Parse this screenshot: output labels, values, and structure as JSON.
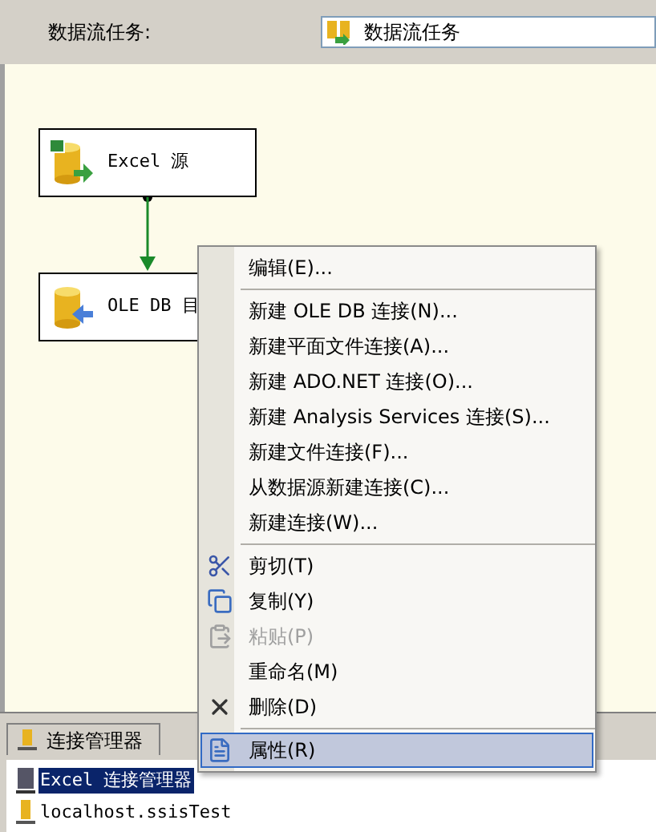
{
  "header": {
    "label": "数据流任务:",
    "combo_value": "数据流任务"
  },
  "canvas": {
    "nodes": [
      {
        "kind": "excel",
        "label": "Excel 源"
      },
      {
        "kind": "oledb",
        "label": "OLE DB 目"
      }
    ]
  },
  "context_menu": [
    {
      "kind": "plain",
      "label": "编辑(E)...",
      "disabled": false,
      "selected": false
    },
    {
      "kind": "separator"
    },
    {
      "kind": "plain",
      "label": "新建 OLE DB 连接(N)...",
      "disabled": false,
      "selected": false
    },
    {
      "kind": "plain",
      "label": "新建平面文件连接(A)...",
      "disabled": false,
      "selected": false
    },
    {
      "kind": "plain",
      "label": "新建 ADO.NET 连接(O)...",
      "disabled": false,
      "selected": false
    },
    {
      "kind": "plain",
      "label": "新建 Analysis Services 连接(S)...",
      "disabled": false,
      "selected": false
    },
    {
      "kind": "plain",
      "label": "新建文件连接(F)...",
      "disabled": false,
      "selected": false
    },
    {
      "kind": "plain",
      "label": "从数据源新建连接(C)...",
      "disabled": false,
      "selected": false
    },
    {
      "kind": "plain",
      "label": "新建连接(W)...",
      "disabled": false,
      "selected": false
    },
    {
      "kind": "separator"
    },
    {
      "kind": "cut",
      "label": "剪切(T)",
      "disabled": false,
      "selected": false
    },
    {
      "kind": "copy",
      "label": "复制(Y)",
      "disabled": false,
      "selected": false
    },
    {
      "kind": "paste",
      "label": "粘贴(P)",
      "disabled": true,
      "selected": false
    },
    {
      "kind": "plain",
      "label": "重命名(M)",
      "disabled": false,
      "selected": false
    },
    {
      "kind": "delete",
      "label": "删除(D)",
      "disabled": false,
      "selected": false
    },
    {
      "kind": "separator"
    },
    {
      "kind": "properties",
      "label": "属性(R)",
      "disabled": false,
      "selected": true
    }
  ],
  "connection_panel": {
    "tab": "连接管理器",
    "items": [
      {
        "kind": "excel",
        "label": "Excel 连接管理器",
        "selected": true
      },
      {
        "kind": "db",
        "label": "localhost.ssisTest",
        "selected": false
      }
    ]
  }
}
